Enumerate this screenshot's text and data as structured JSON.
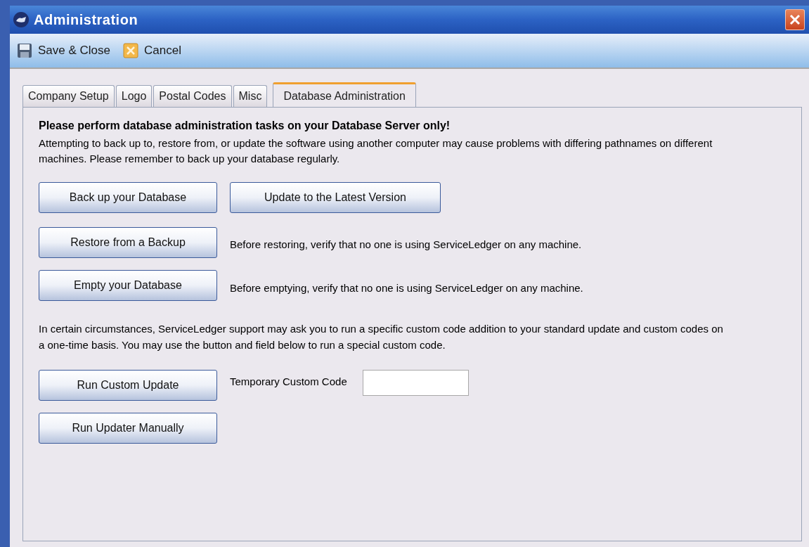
{
  "window": {
    "title": "Administration"
  },
  "toolbar": [
    {
      "kind": "save",
      "label": "Save & Close"
    },
    {
      "kind": "cancel",
      "label": "Cancel"
    }
  ],
  "tabs": [
    {
      "label": "Company Setup",
      "selected": false
    },
    {
      "label": "Logo",
      "selected": false
    },
    {
      "label": "Postal Codes",
      "selected": false
    },
    {
      "label": "Misc",
      "selected": false
    },
    {
      "label": "Database Administration",
      "selected": true
    }
  ],
  "panel": {
    "heading": "Please perform database administration tasks on your Database Server only!",
    "intro": "Attempting to back up to, restore from, or update the software using another computer may cause problems with differing pathnames on different machines. Please remember to back up your database regularly.",
    "backup_button": "Back up your Database",
    "update_button": "Update to the Latest Version",
    "restore_button": "Restore from a Backup",
    "restore_note": "Before restoring, verify that no one is using ServiceLedger on any machine.",
    "empty_button": "Empty your Database",
    "empty_note": "Before emptying, verify that no one is using ServiceLedger on any machine.",
    "custom_note": "In certain circumstances, ServiceLedger support may ask you to run a specific custom code addition to your standard update and custom codes on a one-time basis. You may use the button and field below to run a special custom code.",
    "custom_button": "Run Custom Update",
    "custom_code_label": "Temporary Custom Code",
    "manual_button": "Run Updater Manually"
  }
}
